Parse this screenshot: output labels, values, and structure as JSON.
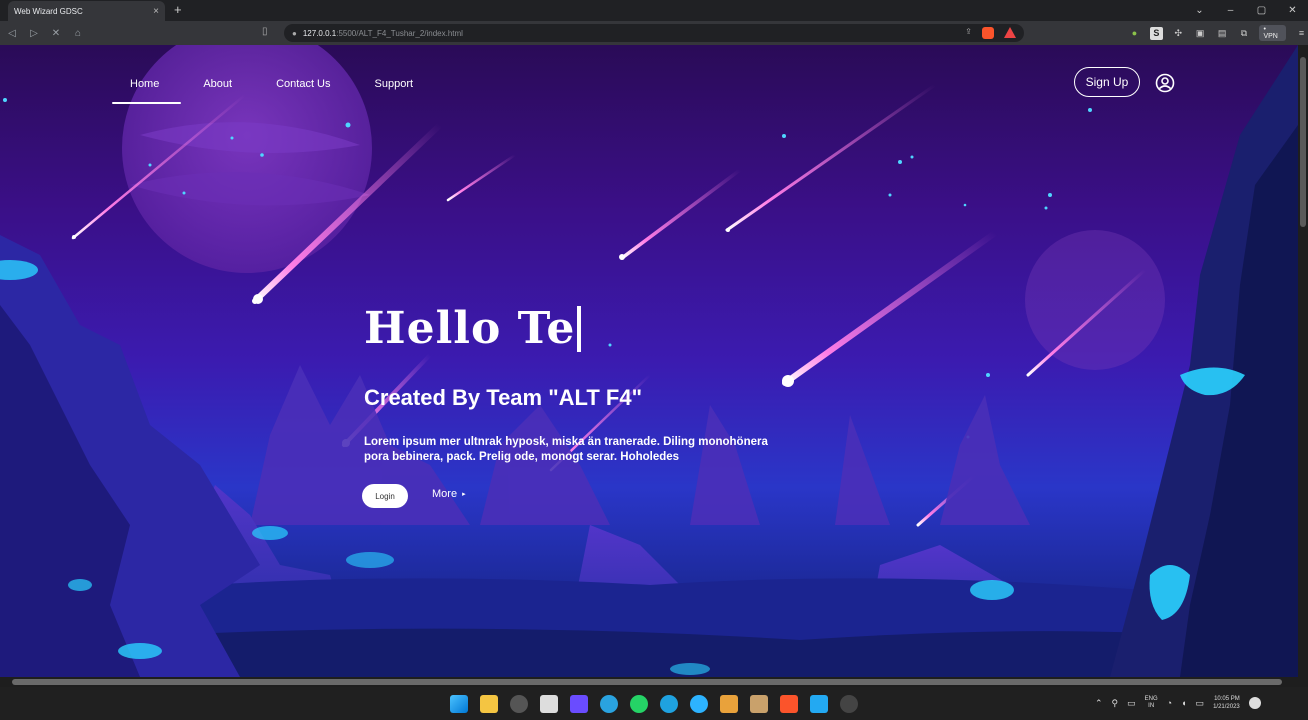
{
  "browser": {
    "tab_title": "Web Wizard GDSC",
    "tab_close": "×",
    "new_tab": "+",
    "url_host": "127.0.0.1",
    "url_path": ":5500/ALT_F4_Tushar_2/index.html",
    "window_controls": [
      "⌄",
      "–",
      "▢",
      "✕"
    ],
    "vpn_label": "• VPN"
  },
  "site": {
    "nav": {
      "items": [
        "Home",
        "About",
        "Contact Us",
        "Support"
      ],
      "active": "Home"
    },
    "signup_label": "Sign Up",
    "hero": {
      "title": "Hello Te",
      "subtitle": "Created By Team \"ALT F4\"",
      "text": "Lorem ipsum mer ultnrak hyposk, miska än tranerade. Diling monohönera pora bebinera, pack. Prelig ode, monogt serar. Hoholedes",
      "login_label": "Login",
      "more_label": "More",
      "more_arrow": "▸"
    }
  },
  "taskbar": {
    "lang": [
      "ENG",
      "IN"
    ],
    "clock": [
      "10:05 PM",
      "1/21/2023"
    ]
  },
  "colors": {
    "accent_meteor": "#ff7de6",
    "sky_top": "#2a0b57",
    "sky_bottom": "#151a66",
    "glow": "#2ad1ff"
  }
}
